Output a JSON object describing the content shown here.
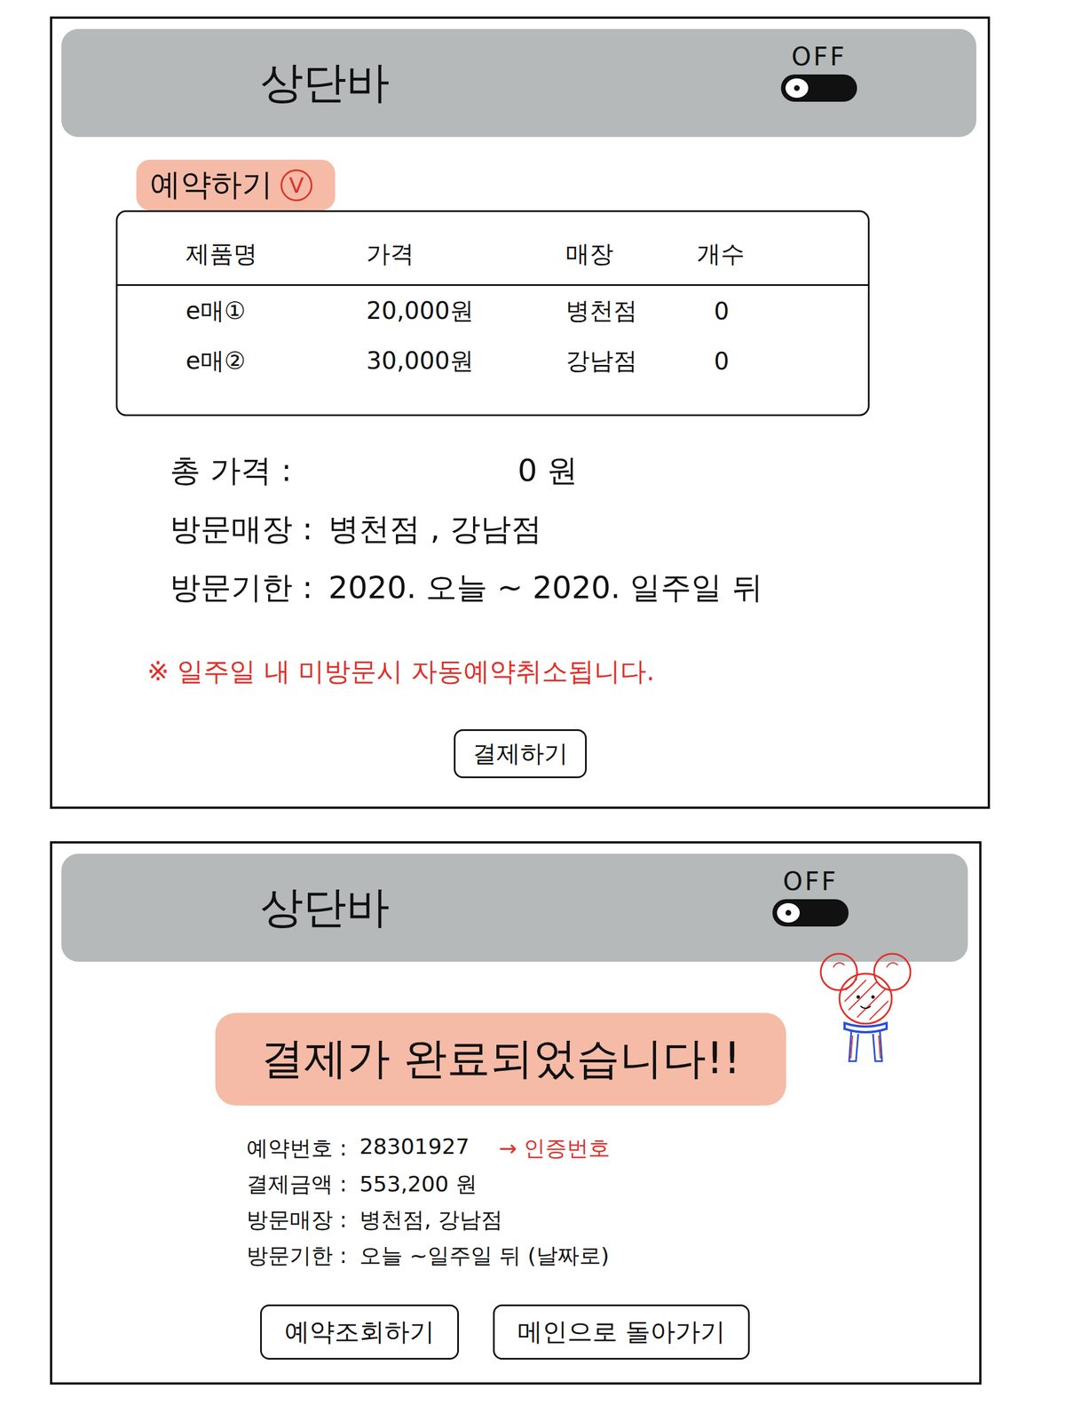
{
  "reservation_screen": {
    "header": {
      "title": "상단바",
      "toggle": {
        "label": "OFF",
        "on": false
      }
    },
    "section": {
      "title": "예약하기",
      "icon": "V"
    },
    "table": {
      "columns": [
        "제품명",
        "가격",
        "매장",
        "개수"
      ],
      "rows": [
        {
          "product": "e매①",
          "price": "20,000원",
          "store": "병천점",
          "count": "0"
        },
        {
          "product": "e매②",
          "price": "30,000원",
          "store": "강남점",
          "count": "0"
        }
      ]
    },
    "total": {
      "label": "총 가격 :",
      "value": "0 원"
    },
    "details": [
      {
        "label": "방문매장 :",
        "value": "병천점 , 강남점"
      },
      {
        "label": "방문기한 :",
        "value": "2020. 오늘 ~ 2020. 일주일 뒤"
      }
    ],
    "notice": "※ 일주일 내 미방문시 자동예약취소됩니다.",
    "button": "결제하기"
  },
  "confirmation_screen": {
    "header": {
      "title": "상단바",
      "toggle": {
        "label": "OFF",
        "on": false
      }
    },
    "banner": "결제가 완료되었습니다!!",
    "details": [
      {
        "label": "예약번호 :",
        "value": "28301927",
        "annotation": "→ 인증번호"
      },
      {
        "label": "결제금액 :",
        "value": "553,200 원"
      },
      {
        "label": "방문매장 :",
        "value": "병천점, 강남점"
      },
      {
        "label": "방문기한 :",
        "value": "오늘 ~일주일 뒤 (날짜로)"
      }
    ],
    "buttons": [
      "예약조회하기",
      "메인으로 돌아가기"
    ]
  }
}
